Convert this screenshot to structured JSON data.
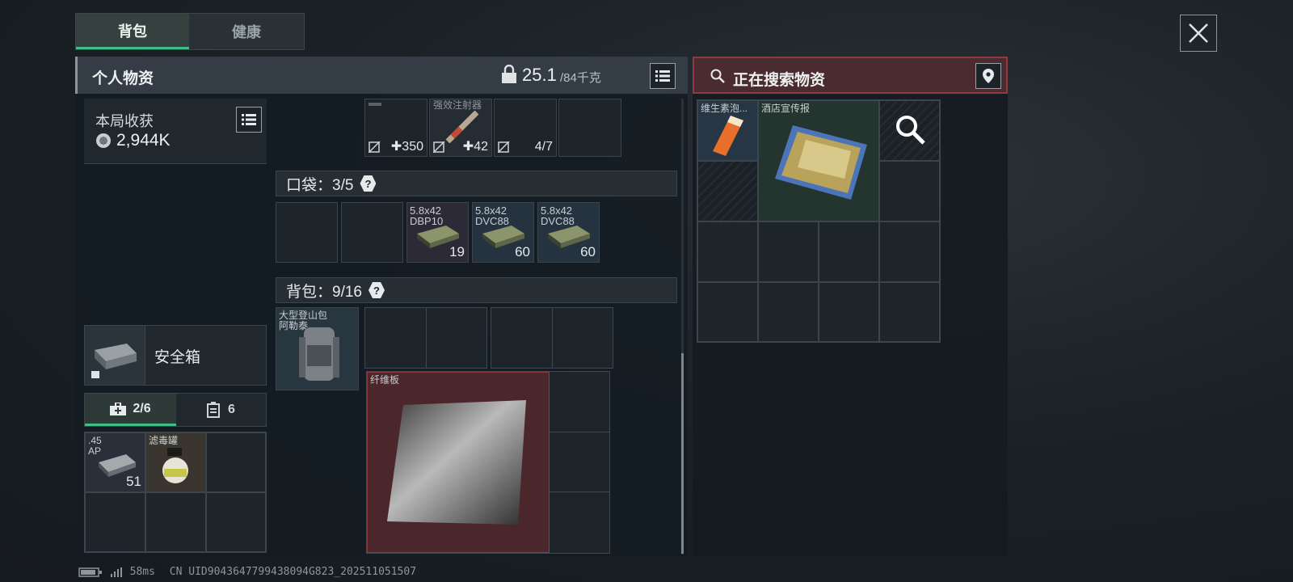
{
  "tabs": [
    {
      "label": "背包"
    },
    {
      "label": "健康"
    }
  ],
  "left": {
    "title": "个人物资",
    "weight_value": "25.1",
    "weight_max": "/84千克",
    "weight_icon": "weight-lock-icon",
    "earnings": {
      "label": "本局收获",
      "value": "2,944K"
    },
    "safebox": {
      "label": "安全箱"
    },
    "lower_tabs": [
      {
        "value": "2/6",
        "icon": "medkit-icon"
      },
      {
        "value": "6",
        "icon": "clipboard-icon"
      }
    ],
    "safe_items": [
      {
        "name": ".45\nAP",
        "count": "51"
      },
      {
        "name": "滤毒罐",
        "count": ""
      }
    ],
    "top_row": [
      {
        "name": "",
        "count": "350"
      },
      {
        "name": "强效注射器",
        "count": "42"
      },
      {
        "name": "",
        "count": "4/7"
      }
    ],
    "pockets": {
      "label": "口袋：3/5",
      "items": [
        {
          "name": "5.8x42\nDBP10",
          "count": "19"
        },
        {
          "name": "5.8x42\nDVC88",
          "count": "60"
        },
        {
          "name": "5.8x42\nDVC88",
          "count": "60"
        }
      ]
    },
    "backpack": {
      "label": "背包：9/16",
      "equipped": "大型登山包\n阿勒泰",
      "item": "纤维板"
    }
  },
  "right": {
    "title": "正在搜索物资",
    "items": [
      {
        "name": "维生素泡..."
      },
      {
        "name": "酒店宣传报"
      }
    ]
  },
  "status": {
    "ping": "58ms",
    "uid": "CN UID9043647799438094G823_202511051507"
  },
  "colors": {
    "accent": "#3fbf86",
    "search_red": "#8e3a41"
  }
}
